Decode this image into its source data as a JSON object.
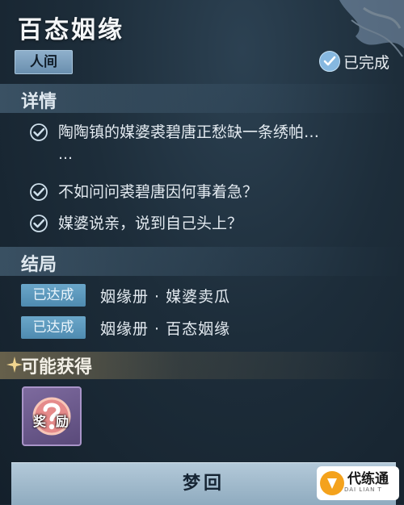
{
  "quest": {
    "title": "百态姻缘",
    "realm_tag": "人间",
    "status": "已完成"
  },
  "details": {
    "heading": "详情",
    "items": [
      {
        "text": "陶陶镇的媒婆裘碧唐正愁缺一条绣帕…",
        "continuation": "…"
      },
      {
        "text": "不如问问裘碧唐因何事着急？"
      },
      {
        "text": "媒婆说亲，说到自己头上？"
      }
    ]
  },
  "endings": {
    "heading": "结局",
    "items": [
      {
        "badge": "已达成",
        "text": "姻缘册 · 媒婆卖瓜"
      },
      {
        "badge": "已达成",
        "text": "姻缘册 · 百态姻缘"
      }
    ]
  },
  "rewards": {
    "heading": "可能获得",
    "item_left": "奖",
    "item_right": "励"
  },
  "action": {
    "button_label": "梦回"
  },
  "watermark": {
    "brand": "代练通",
    "sub": "DAI LIAN T"
  },
  "colors": {
    "background": "#1d2d3a",
    "check": "#cfe0ec",
    "badge": "#5f9bbf",
    "button": "#a3bccd",
    "reward_bg": "#6b5a8c"
  }
}
